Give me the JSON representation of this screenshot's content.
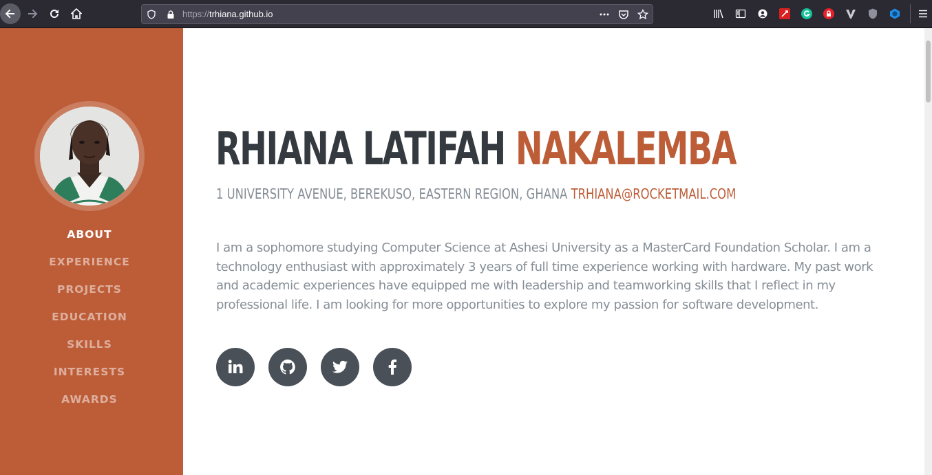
{
  "browser": {
    "url_protocol": "https://",
    "url_host": "trhiana.github.io",
    "colors": {
      "toolbar": "#2b2a33",
      "urlbar": "#42414d"
    },
    "toolbar_icons": [
      "back-icon",
      "forward-icon",
      "reload-icon",
      "home-icon",
      "tracking-shield-icon",
      "lock-icon",
      "page-actions-icon",
      "pocket-icon",
      "bookmark-star-icon",
      "library-icon",
      "sidebar-icon",
      "account-icon",
      "extension-red-icon",
      "grammarly-icon",
      "extension-lock-icon",
      "extension-v-icon",
      "extension-shield-icon",
      "extension-blue-cube-icon",
      "menu-icon"
    ]
  },
  "sidebar": {
    "background": "#bd5d38",
    "nav": [
      {
        "label": "ABOUT"
      },
      {
        "label": "EXPERIENCE"
      },
      {
        "label": "PROJECTS"
      },
      {
        "label": "EDUCATION"
      },
      {
        "label": "SKILLS"
      },
      {
        "label": "INTERESTS"
      },
      {
        "label": "AWARDS"
      }
    ],
    "active_index": 0
  },
  "about": {
    "first_name": "RHIANA LATIFAH",
    "last_name": "NAKALEMBA",
    "address": "1 UNIVERSITY AVENUE, BEREKUSO, EASTERN REGION, GHANA",
    "email": "TRHIANA@ROCKETMAIL.COM",
    "bio": "I am a sophomore studying Computer Science at Ashesi University as a MasterCard Foundation Scholar. I am a technology enthusiast with approximately 3 years of full time experience working with hardware. My past work and academic experiences have equipped me with leadership and teamworking skills that I reflect in my professional life. I am looking for more opportunities to explore my passion for software development.",
    "social": [
      "linkedin-icon",
      "github-icon",
      "twitter-icon",
      "facebook-icon"
    ],
    "colors": {
      "primary": "#bd5d38",
      "heading": "#343a40",
      "muted": "#868e96",
      "social_bg": "#495057"
    }
  }
}
